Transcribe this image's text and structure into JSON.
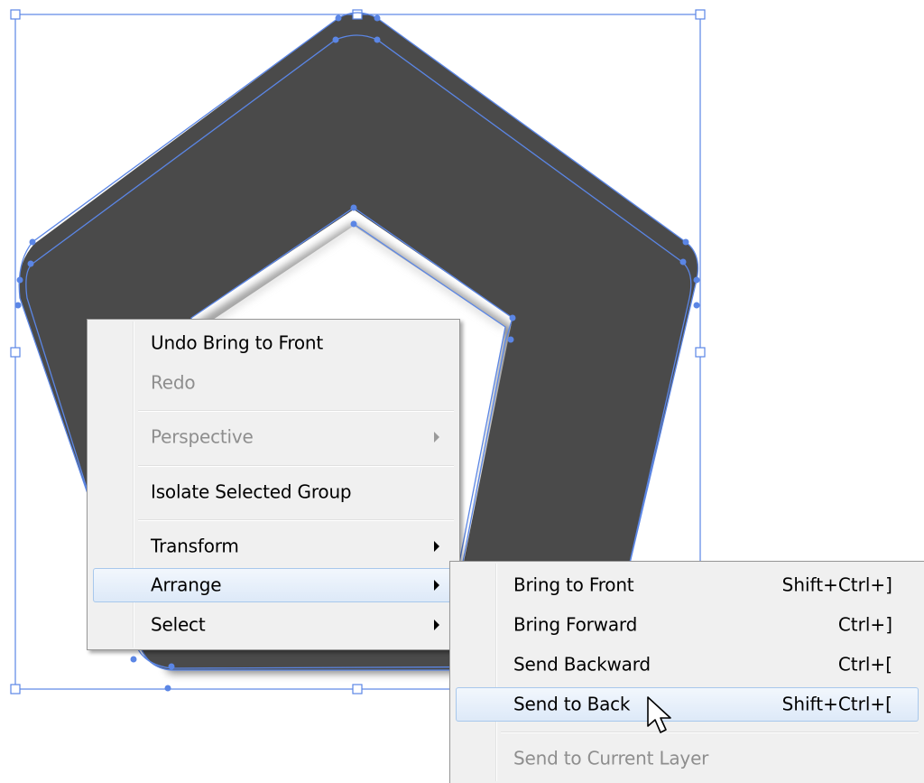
{
  "colors": {
    "shape_fill": "#4a4a4a",
    "selection": "#5b86e5",
    "menu_bg": "#f0f0f0",
    "menu_border": "#979797",
    "highlight_border": "#a8c8ec",
    "disabled_text": "#8e8e8e"
  },
  "context_menu": {
    "items": [
      {
        "label": "Undo Bring to Front",
        "enabled": true
      },
      {
        "label": "Redo",
        "enabled": false
      },
      {
        "label": "Perspective",
        "enabled": false,
        "submenu": true
      },
      {
        "label": "Isolate Selected Group",
        "enabled": true
      },
      {
        "label": "Transform",
        "enabled": true,
        "submenu": true
      },
      {
        "label": "Arrange",
        "enabled": true,
        "submenu": true,
        "highlighted": true
      },
      {
        "label": "Select",
        "enabled": true,
        "submenu": true
      }
    ]
  },
  "arrange_submenu": {
    "items": [
      {
        "label": "Bring to Front",
        "shortcut": "Shift+Ctrl+]",
        "enabled": true
      },
      {
        "label": "Bring Forward",
        "shortcut": "Ctrl+]",
        "enabled": true
      },
      {
        "label": "Send Backward",
        "shortcut": "Ctrl+[",
        "enabled": true
      },
      {
        "label": "Send to Back",
        "shortcut": "Shift+Ctrl+[",
        "enabled": true,
        "highlighted": true
      },
      {
        "label": "Send to Current Layer",
        "enabled": false
      }
    ]
  },
  "cursor": {
    "icon": "arrow-pointer-icon"
  }
}
